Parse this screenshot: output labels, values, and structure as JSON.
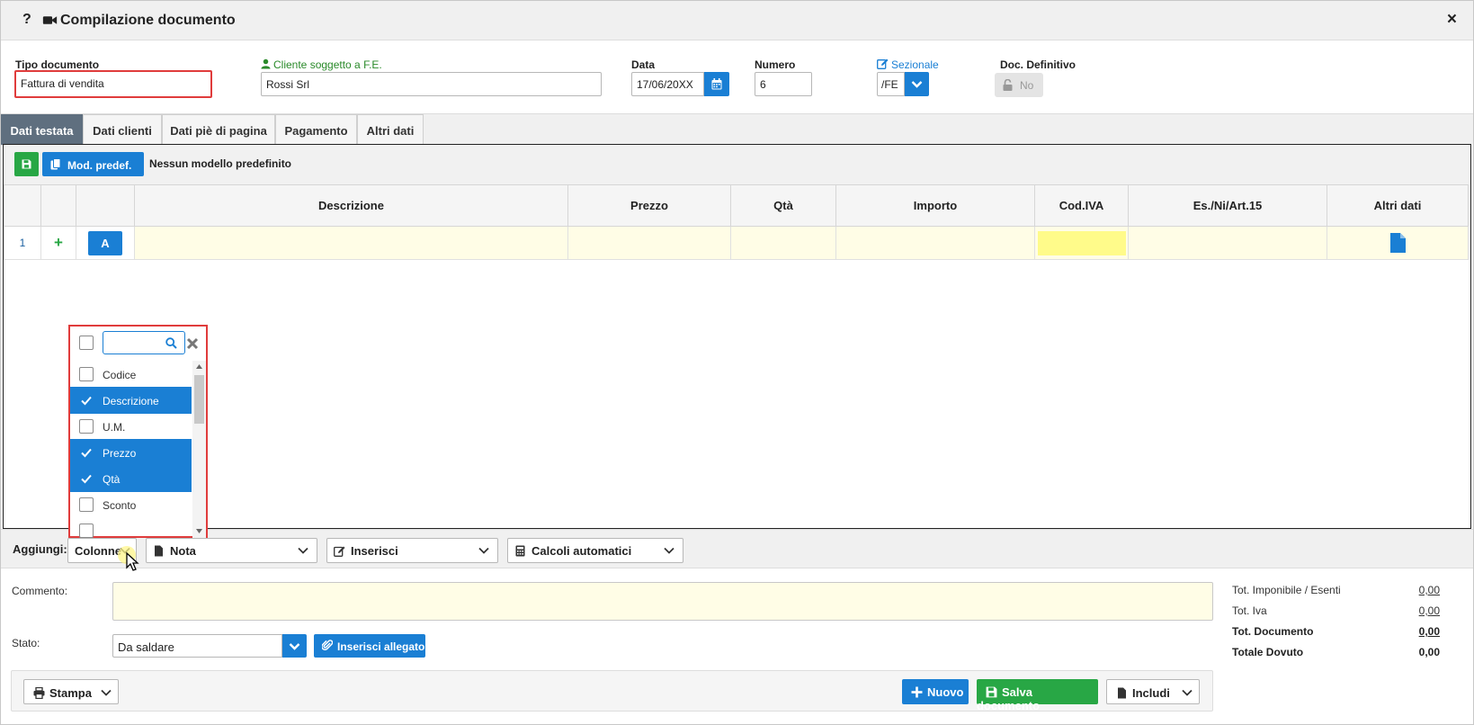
{
  "window": {
    "help": "?",
    "title": "Compilazione documento",
    "close": "×"
  },
  "header": {
    "tipo_documento": {
      "label": "Tipo documento",
      "value": "Fattura di vendita"
    },
    "cliente": {
      "label": "Cliente soggetto a F.E.",
      "value": "Rossi Srl"
    },
    "data": {
      "label": "Data",
      "value": "17/06/20XX"
    },
    "numero": {
      "label": "Numero",
      "value": "6"
    },
    "sezionale": {
      "label": "Sezionale",
      "value": "/FE"
    },
    "doc_definitivo": {
      "label": "Doc. Definitivo",
      "value": "No"
    }
  },
  "tabs": [
    {
      "label": "Dati testata",
      "active": true
    },
    {
      "label": "Dati clienti",
      "active": false
    },
    {
      "label": "Dati piè di pagina",
      "active": false
    },
    {
      "label": "Pagamento",
      "active": false
    },
    {
      "label": "Altri dati",
      "active": false
    }
  ],
  "toolbar": {
    "mod_predef_label": "Mod. predef.",
    "no_model_text": "Nessun modello predefinito"
  },
  "grid": {
    "columns": [
      "",
      "",
      "",
      "Descrizione",
      "Prezzo",
      "Qtà",
      "Importo",
      "Cod.IVA",
      "Es./Ni/Art.15",
      "Altri dati"
    ],
    "rows": [
      {
        "num": "1",
        "add": "+",
        "type": "A"
      }
    ]
  },
  "column_picker": {
    "search_placeholder": "",
    "items": [
      {
        "label": "Codice",
        "checked": false
      },
      {
        "label": "Descrizione",
        "checked": true
      },
      {
        "label": "U.M.",
        "checked": false
      },
      {
        "label": "Prezzo",
        "checked": true
      },
      {
        "label": "Qtà",
        "checked": true
      },
      {
        "label": "Sconto",
        "checked": false
      }
    ]
  },
  "add_bar": {
    "label": "Aggiungi:",
    "colonne": "Colonne",
    "nota": "Nota",
    "inserisci": "Inserisci",
    "calcoli": "Calcoli automatici"
  },
  "footer": {
    "commento_label": "Commento:",
    "stato_label": "Stato:",
    "stato_value": "Da saldare",
    "allegato_label": "Inserisci allegato"
  },
  "totals": [
    {
      "label": "Tot. Imponibile / Esenti",
      "value": "0,00"
    },
    {
      "label": "Tot. Iva",
      "value": "0,00"
    },
    {
      "label": "Tot. Documento",
      "value": "0,00"
    },
    {
      "label": "Totale Dovuto",
      "value": "0,00"
    }
  ],
  "actions": {
    "stampa": "Stampa",
    "nuovo": "Nuovo",
    "salva": "Salva documento",
    "includi": "Includi"
  },
  "colors": {
    "primary": "#1a7fd4",
    "success": "#28a745",
    "highlight": "#e03c3c",
    "row_bg": "#fffde6",
    "iva_bg": "#fffb8a"
  }
}
